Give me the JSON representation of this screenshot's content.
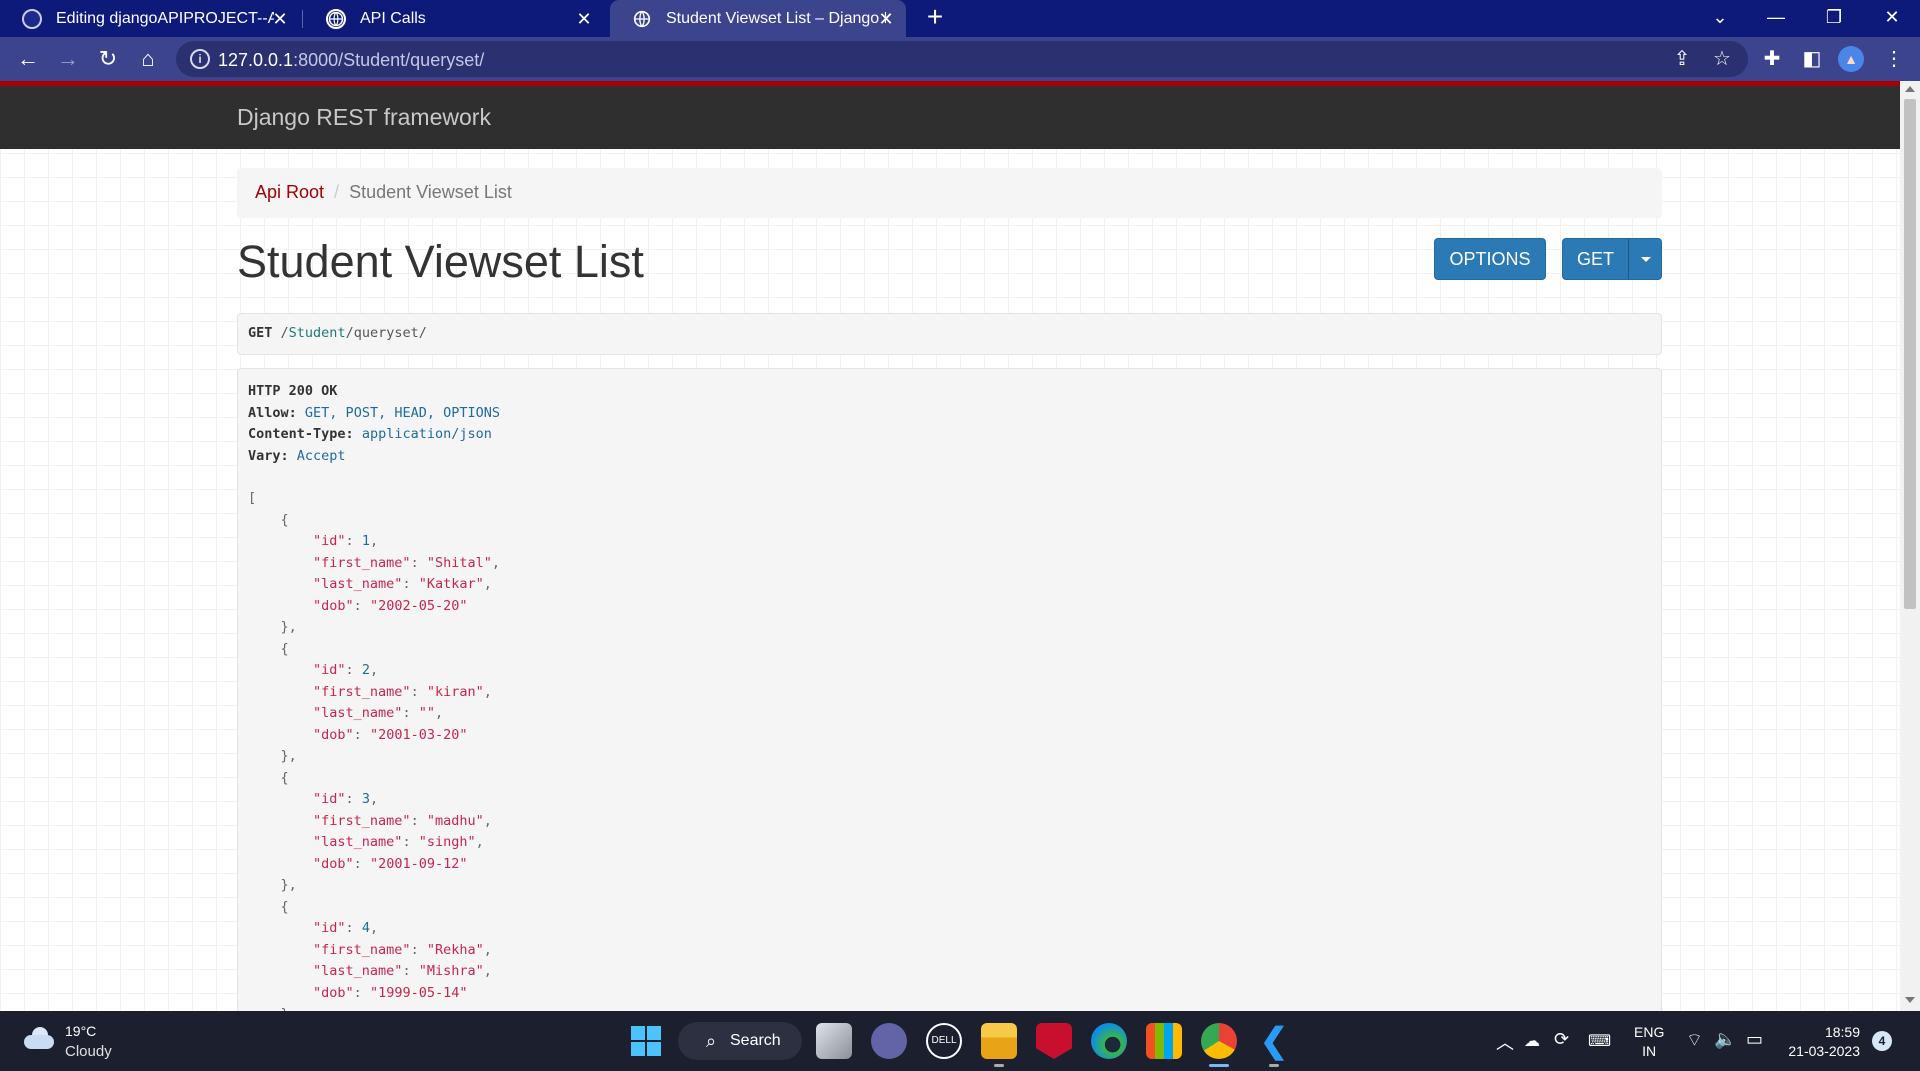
{
  "browser": {
    "tabs": [
      {
        "title": "Editing djangoAPIPROJECT--API\\",
        "close": "✕"
      },
      {
        "title": "API Calls",
        "close": "✕"
      },
      {
        "title": "Student Viewset List – Django RE",
        "close": "✕"
      }
    ],
    "new_tab": "+",
    "address": {
      "host": "127.0.0.1",
      "rest": ":8000/Student/queryset/"
    }
  },
  "page": {
    "brand": "Django REST framework",
    "breadcrumb": {
      "root": "Api Root",
      "sep": "/",
      "current": "Student Viewset List"
    },
    "title": "Student Viewset List",
    "buttons": {
      "options": "OPTIONS",
      "get": "GET"
    },
    "request": {
      "method": "GET",
      "path_prefix": "/",
      "seg1": "Student",
      "path_mid": "/",
      "seg2": "queryset",
      "path_end": "/"
    },
    "response": {
      "status": "HTTP 200 OK",
      "headers": [
        {
          "name": "Allow:",
          "value": "GET, POST, HEAD, OPTIONS"
        },
        {
          "name": "Content-Type:",
          "value": "application/json"
        },
        {
          "name": "Vary:",
          "value": "Accept"
        }
      ],
      "records": [
        {
          "id": "1",
          "first_name": "\"Shital\"",
          "last_name": "\"Katkar\"",
          "dob": "\"2002-05-20\""
        },
        {
          "id": "2",
          "first_name": "\"kiran\"",
          "last_name": "\"\"",
          "dob": "\"2001-03-20\""
        },
        {
          "id": "3",
          "first_name": "\"madhu\"",
          "last_name": "\"singh\"",
          "dob": "\"2001-09-12\""
        },
        {
          "id": "4",
          "first_name": "\"Rekha\"",
          "last_name": "\"Mishra\"",
          "dob": "\"1999-05-14\""
        }
      ]
    }
  },
  "taskbar": {
    "weather": {
      "temp": "19°C",
      "condition": "Cloudy"
    },
    "search": "Search",
    "lang": {
      "line1": "ENG",
      "line2": "IN"
    },
    "clock": {
      "time": "18:59",
      "date": "21-03-2023"
    },
    "notifications": "4"
  }
}
